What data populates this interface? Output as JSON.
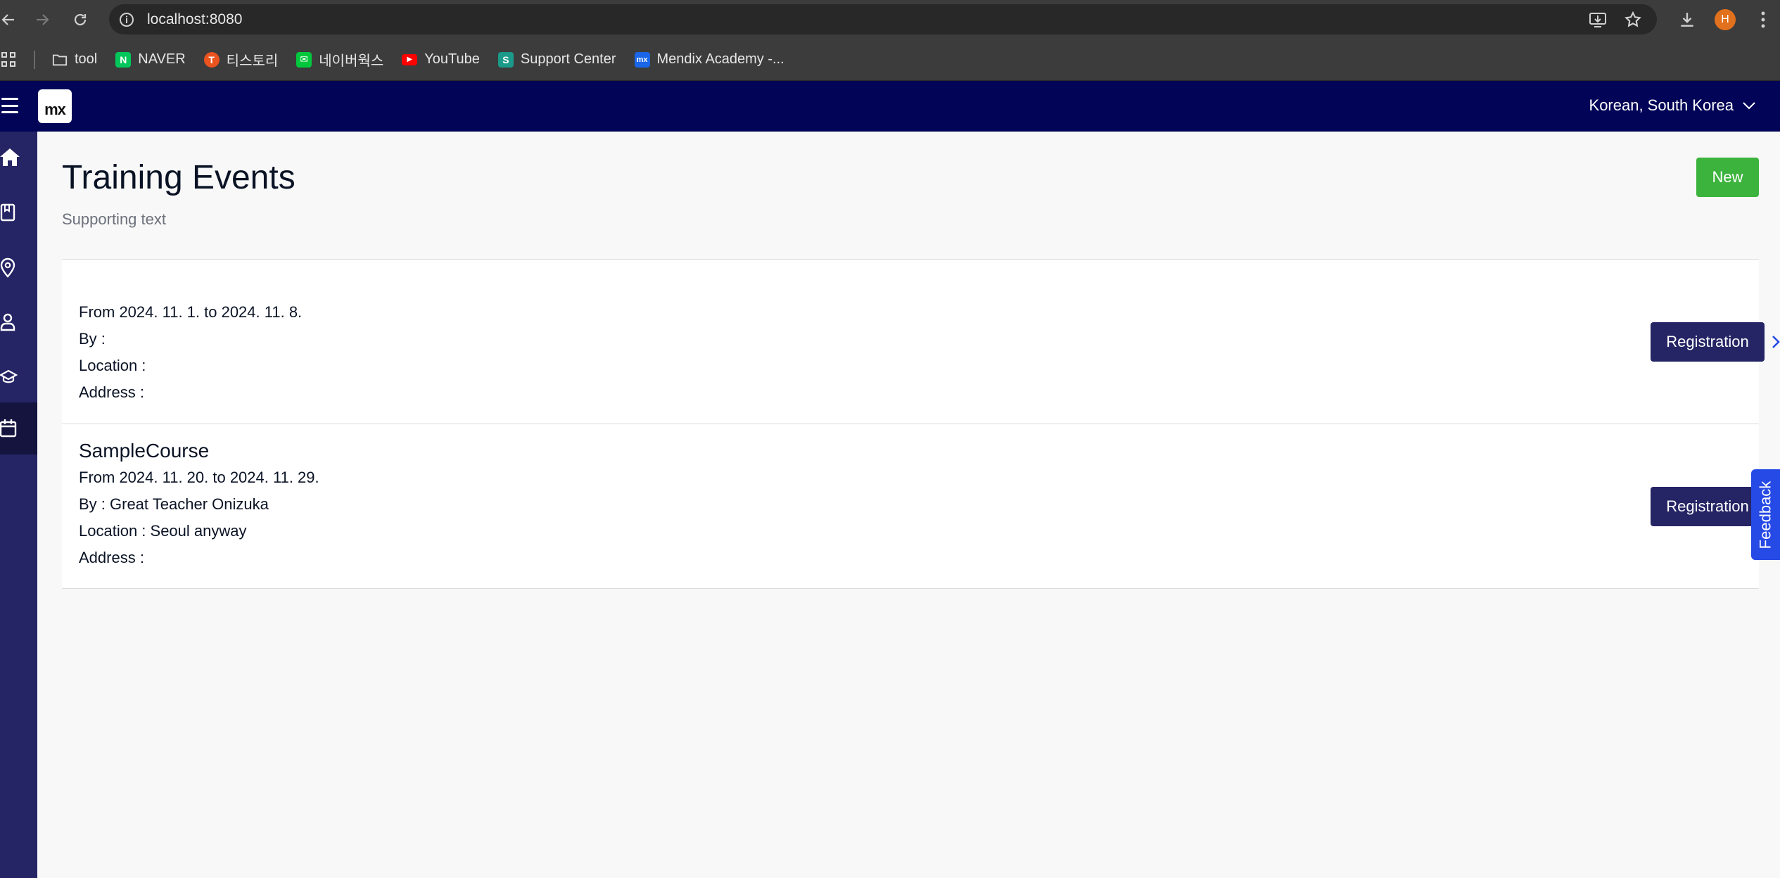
{
  "browser": {
    "url": "localhost:8080",
    "profile_initial": "H",
    "bookmarks": [
      {
        "label": "tool",
        "icon": "folder-icon"
      },
      {
        "label": "NAVER",
        "icon": "naver-icon",
        "glyph": "N",
        "color": "#03c75a"
      },
      {
        "label": "티스토리",
        "icon": "tistory-icon",
        "glyph": "T",
        "color": "#eb531f"
      },
      {
        "label": "네이버웍스",
        "icon": "naverworks-icon",
        "glyph": "✉",
        "color": "#00c73c"
      },
      {
        "label": "YouTube",
        "icon": "youtube-icon",
        "glyph": "▶",
        "color": "#ff0000"
      },
      {
        "label": "Support Center",
        "icon": "support-center-icon",
        "glyph": "S",
        "color": "#1b9a8a"
      },
      {
        "label": "Mendix Academy -...",
        "icon": "mendix-academy-icon",
        "glyph": "mx",
        "color": "#1a66e8"
      }
    ]
  },
  "app": {
    "logo": "mx",
    "language": "Korean, South Korea",
    "sidebar": [
      {
        "name": "home-icon",
        "active": false
      },
      {
        "name": "book-icon",
        "active": false
      },
      {
        "name": "location-icon",
        "active": false
      },
      {
        "name": "user-icon",
        "active": false
      },
      {
        "name": "graduation-cap-icon",
        "active": false
      },
      {
        "name": "calendar-icon",
        "active": true
      }
    ]
  },
  "page": {
    "title": "Training Events",
    "supporting_text": "Supporting text",
    "new_label": "New",
    "events": [
      {
        "title": "",
        "dates": "From 2024. 11. 1. to 2024. 11. 8.",
        "by": "By :",
        "location": "Location :",
        "address": "Address :",
        "button": "Registration"
      },
      {
        "title": "SampleCourse",
        "dates": "From 2024. 11. 20. to 2024. 11. 29.",
        "by": "By : Great Teacher Onizuka",
        "location": "Location : Seoul anyway",
        "address": "Address :",
        "button": "Registration"
      }
    ]
  },
  "feedback": "Feedback",
  "colors": {
    "header": "#020557",
    "sidebar": "#252465",
    "primary_button": "#252465",
    "success_button": "#3cb33d",
    "feedback": "#264ae5"
  }
}
